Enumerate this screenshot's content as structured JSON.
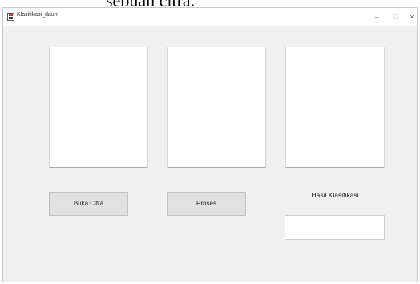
{
  "caption_fragment": "sebuah citra.",
  "window": {
    "title": "Klasifikasi_daun",
    "minimize_glyph": "–",
    "maximize_glyph": "□",
    "close_glyph": "×"
  },
  "buttons": {
    "open_image": "Buka Citra",
    "process": "Proses"
  },
  "result": {
    "label": "Hasil Klasifikasi",
    "value": ""
  },
  "icons": {
    "app": "app-window-icon"
  }
}
